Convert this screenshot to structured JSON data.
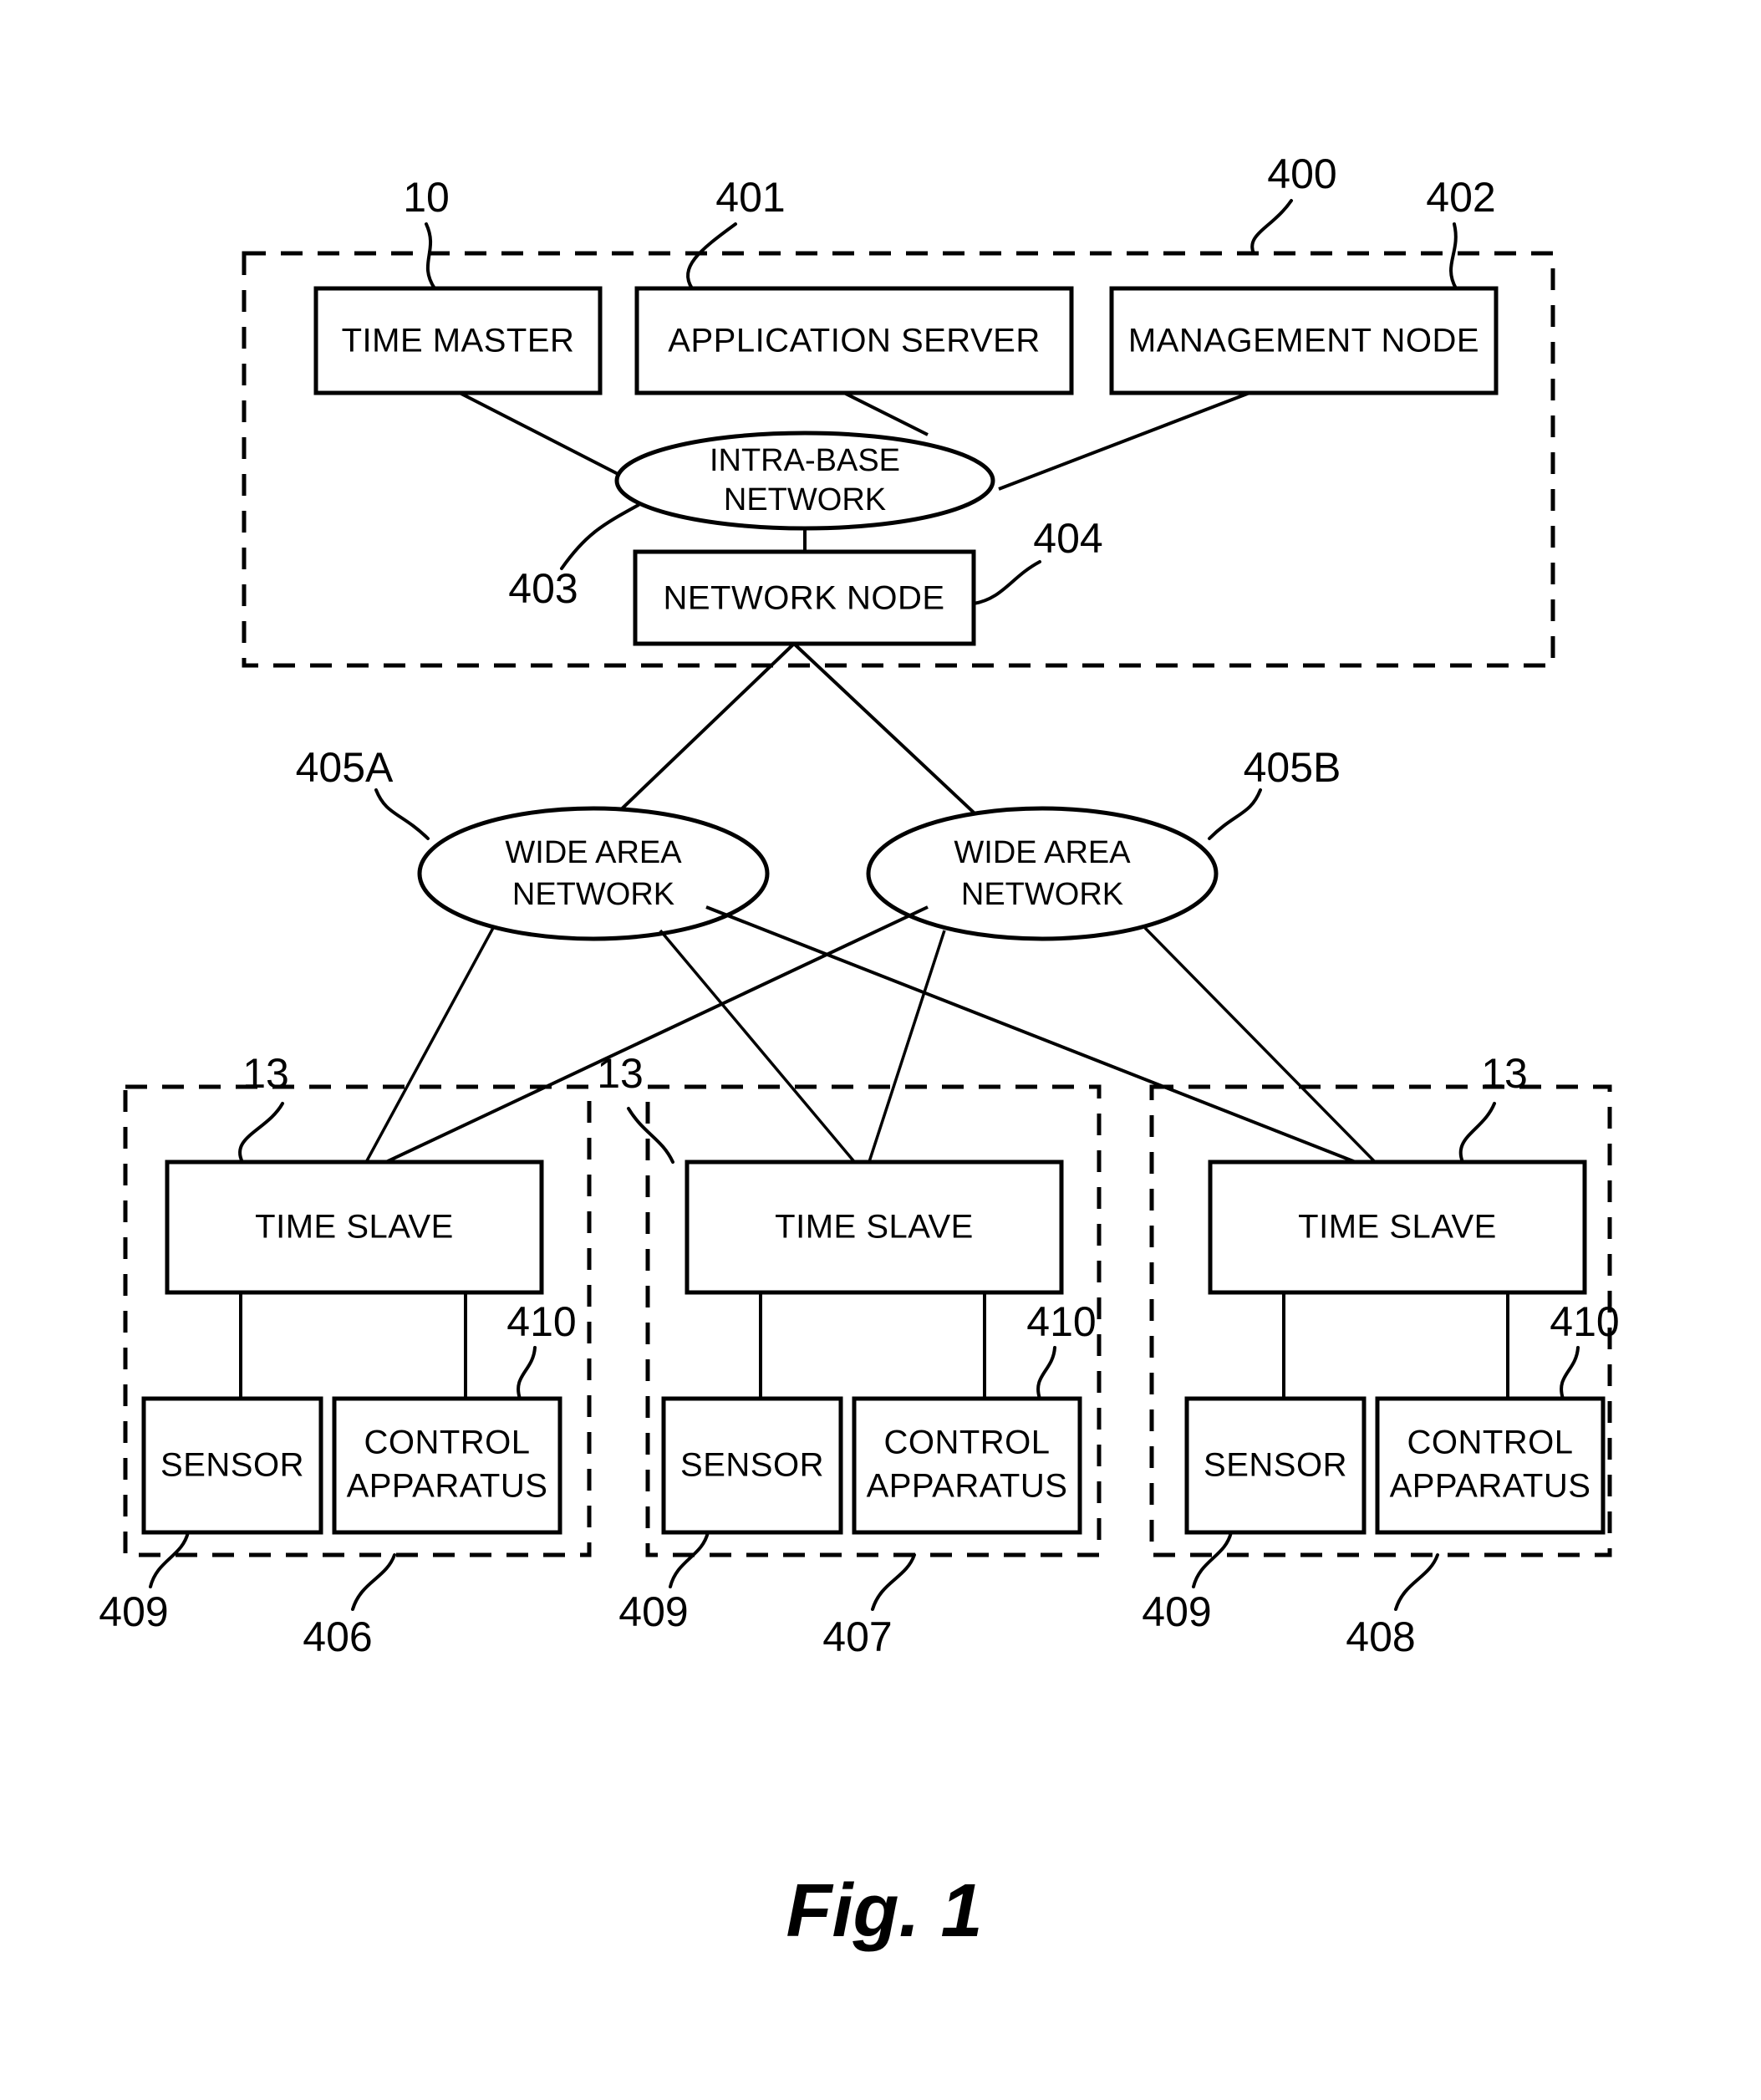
{
  "figure": {
    "caption": "Fig. 1",
    "top_panel": {
      "ref": "400",
      "boxes": [
        {
          "label": "TIME MASTER",
          "ref": "10"
        },
        {
          "label": "APPLICATION SERVER",
          "ref": "401"
        },
        {
          "label": "MANAGEMENT NODE",
          "ref": "402"
        }
      ],
      "cloud": {
        "line1": "INTRA-BASE",
        "line2": "NETWORK",
        "ref": "403"
      },
      "network_node": {
        "label": "NETWORK NODE",
        "ref": "404"
      }
    },
    "wan": [
      {
        "line1": "WIDE AREA",
        "line2": "NETWORK",
        "ref": "405A"
      },
      {
        "line1": "WIDE AREA",
        "line2": "NETWORK",
        "ref": "405B"
      }
    ],
    "sites": [
      {
        "ref": "406",
        "time_slave": {
          "label": "TIME SLAVE",
          "ref": "13"
        },
        "sensor": {
          "label": "SENSOR",
          "ref": "409"
        },
        "control": {
          "line1": "CONTROL",
          "line2": "APPARATUS",
          "ref": "410"
        }
      },
      {
        "ref": "407",
        "time_slave": {
          "label": "TIME SLAVE",
          "ref": "13"
        },
        "sensor": {
          "label": "SENSOR",
          "ref": "409"
        },
        "control": {
          "line1": "CONTROL",
          "line2": "APPARATUS",
          "ref": "410"
        }
      },
      {
        "ref": "408",
        "time_slave": {
          "label": "TIME SLAVE",
          "ref": "13"
        },
        "sensor": {
          "label": "SENSOR",
          "ref": "409"
        },
        "control": {
          "line1": "CONTROL",
          "line2": "APPARATUS",
          "ref": "410"
        }
      }
    ],
    "colors": {
      "ink": "#000000",
      "paper": "#ffffff"
    }
  }
}
